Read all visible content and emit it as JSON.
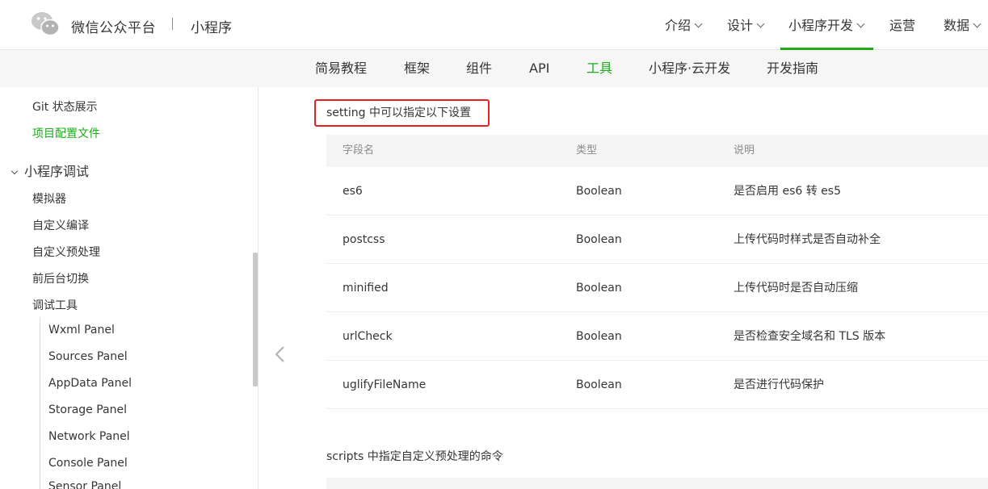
{
  "header": {
    "brand": "微信公众平台",
    "sub": "小程序",
    "nav": [
      {
        "label": "介绍",
        "chevron": true
      },
      {
        "label": "设计",
        "chevron": true
      },
      {
        "label": "小程序开发",
        "chevron": true,
        "active": true
      },
      {
        "label": "运营",
        "chevron": false
      },
      {
        "label": "数据",
        "chevron": true
      }
    ]
  },
  "subnav": [
    "简易教程",
    "框架",
    "组件",
    "API",
    "工具",
    "小程序·云开发",
    "开发指南"
  ],
  "subnav_active": "工具",
  "sidebar": {
    "items": [
      {
        "label": "Git 状态展示"
      },
      {
        "label": "项目配置文件",
        "active": true
      },
      {
        "label": "小程序调试",
        "group": true
      },
      {
        "label": "模拟器"
      },
      {
        "label": "自定义编译"
      },
      {
        "label": "自定义预处理"
      },
      {
        "label": "前后台切换"
      },
      {
        "label": "调试工具"
      },
      {
        "label": "Wxml Panel"
      },
      {
        "label": "Sources Panel"
      },
      {
        "label": "AppData Panel"
      },
      {
        "label": "Storage Panel"
      },
      {
        "label": "Network Panel"
      },
      {
        "label": "Console Panel"
      },
      {
        "label": "Sensor Panel"
      }
    ]
  },
  "content": {
    "setting_note": "setting 中可以指定以下设置",
    "table": {
      "headers": [
        "字段名",
        "类型",
        "说明"
      ],
      "rows": [
        [
          "es6",
          "Boolean",
          "是否启用 es6 转 es5"
        ],
        [
          "postcss",
          "Boolean",
          "上传代码时样式是否自动补全"
        ],
        [
          "minified",
          "Boolean",
          "上传代码时是否自动压缩"
        ],
        [
          "urlCheck",
          "Boolean",
          "是否检查安全域名和 TLS 版本"
        ],
        [
          "uglifyFileName",
          "Boolean",
          "是否进行代码保护"
        ]
      ]
    },
    "scripts_note": "scripts 中指定自定义预处理的命令"
  },
  "colors": {
    "accent": "#1aad19",
    "highlight_border": "#e8201f"
  }
}
